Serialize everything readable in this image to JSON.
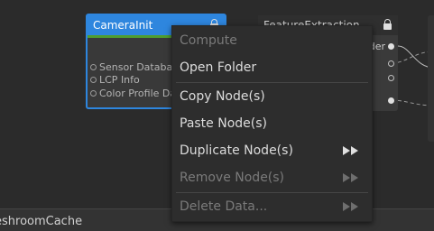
{
  "graph": {
    "camera_node": {
      "title": "CameraInit",
      "attributes": [
        "Sensor Database",
        "LCP Info",
        "Color Profile Database"
      ]
    },
    "feature_node": {
      "title": "FeatureExtraction",
      "output_label": "der"
    }
  },
  "status_bar": {
    "text": "eshroomCache"
  },
  "context_menu": {
    "items": [
      {
        "label": "Compute",
        "enabled": false,
        "has_submenu": false
      },
      {
        "label": "Open Folder",
        "enabled": true,
        "has_submenu": false
      },
      {
        "label": "Copy Node(s)",
        "enabled": true,
        "has_submenu": false
      },
      {
        "label": "Paste Node(s)",
        "enabled": true,
        "has_submenu": false
      },
      {
        "label": "Duplicate Node(s)",
        "enabled": true,
        "has_submenu": true
      },
      {
        "label": "Remove Node(s)",
        "enabled": false,
        "has_submenu": true
      },
      {
        "label": "Delete Data...",
        "enabled": false,
        "has_submenu": true
      }
    ]
  },
  "colors": {
    "background": "#2b2b2b",
    "selection_accent": "#2e86de",
    "status_green": "#4f9d2f",
    "menu_background": "#2d2d2d"
  },
  "icons": [
    "lock-icon",
    "submenu-arrow-icon",
    "port-icon"
  ]
}
